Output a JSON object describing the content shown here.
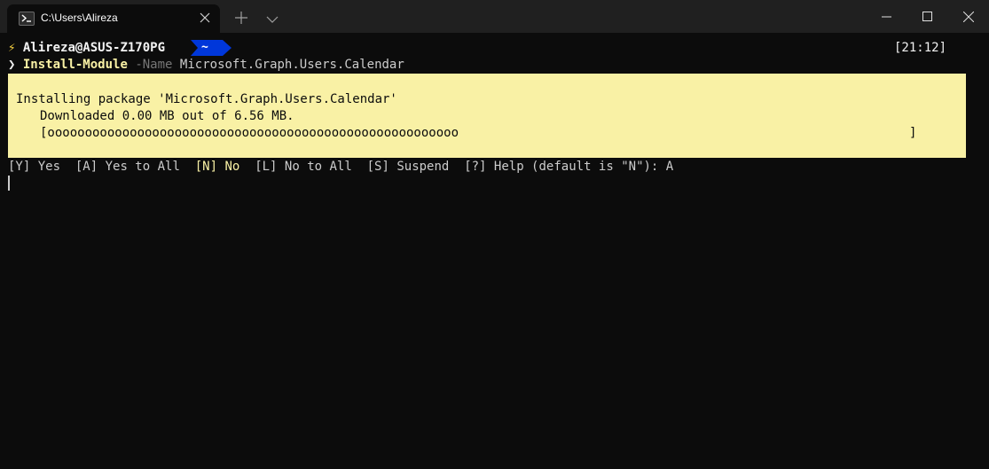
{
  "window": {
    "tab_title": "C:\\Users\\Alireza"
  },
  "prompt": {
    "bolt": "⚡",
    "user_host": "Alireza@ASUS-Z170PG",
    "path_segment": "~",
    "time": "[21:12]"
  },
  "command": {
    "chevron": "❯",
    "name": "Install-Module",
    "param": "-Name",
    "value": "Microsoft.Graph.Users.Calendar"
  },
  "progress": {
    "line1": "Installing package 'Microsoft.Graph.Users.Calendar'",
    "line2": "Downloaded 0.00 MB out of 6.56 MB.",
    "bar": "[ooooooooooooooooooooooooooooooooooooooooooooooooooooooo",
    "bar_end": "]"
  },
  "confirm": {
    "yes": "[Y] Yes",
    "yes_all": "[A] Yes to All",
    "no": "[N] No",
    "no_all": "[L] No to All",
    "suspend": "[S] Suspend",
    "help": "[?] Help (default is \"N\"): A"
  },
  "colors": {
    "background": "#0c0c0c",
    "titlebar": "#202020",
    "progress_bg": "#f9f1a5",
    "accent_blue": "#0037da"
  }
}
